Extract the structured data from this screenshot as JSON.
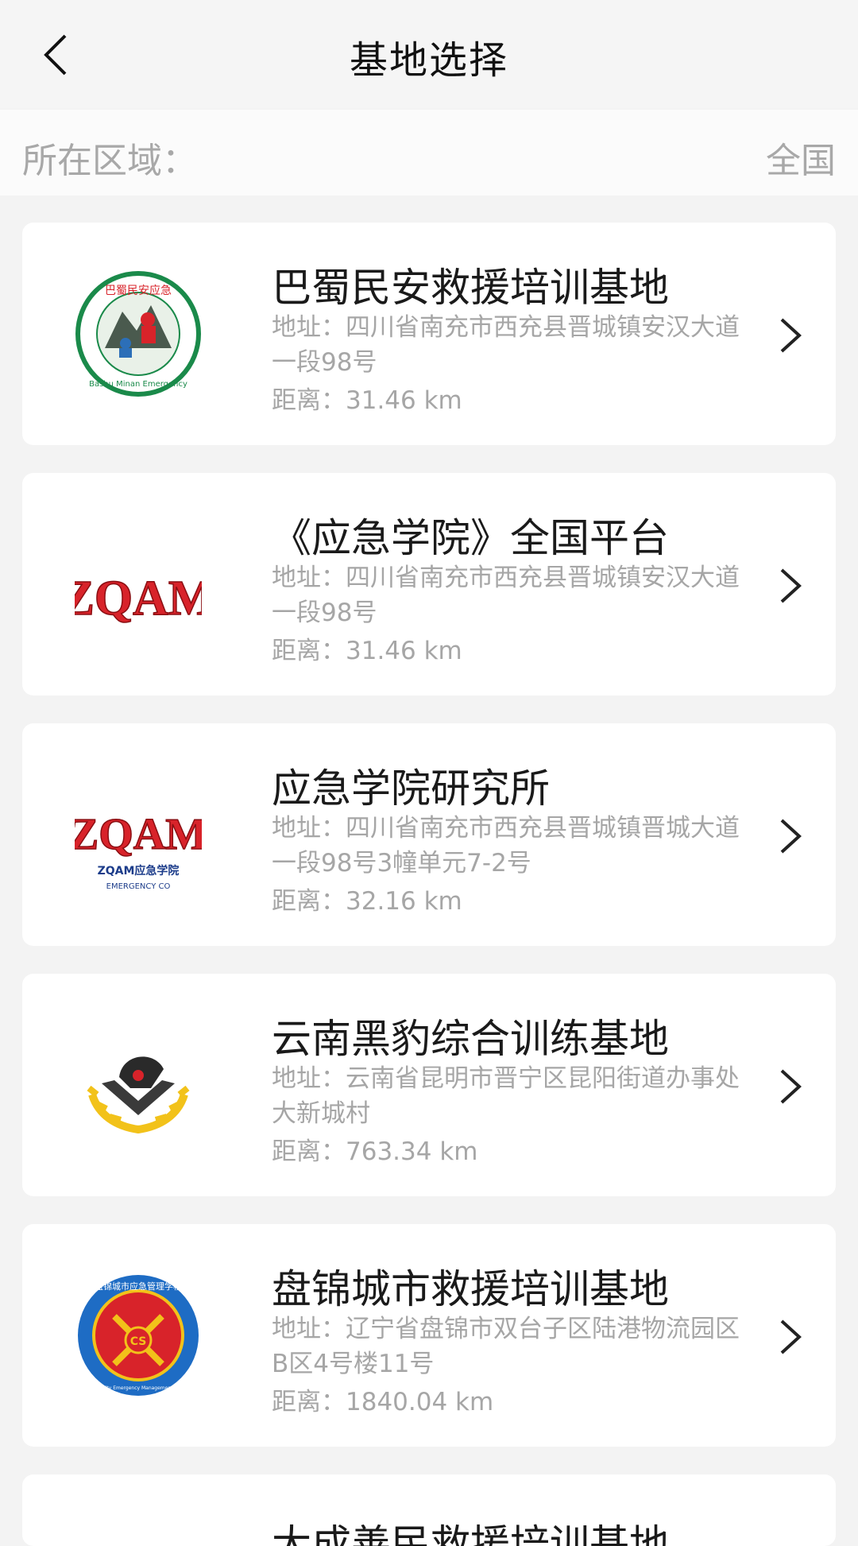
{
  "header": {
    "title": "基地选择"
  },
  "region": {
    "label": "所在区域：",
    "value": "全国"
  },
  "bases": [
    {
      "name": "巴蜀民安救援培训基地",
      "address": "地址：四川省南充市西充县晋城镇安汉大道一段98号",
      "distance": "距离：31.46 km",
      "logo": "bashu-minan-emergency-logo",
      "logo_text_top": "巴蜀民安应急",
      "logo_text_bottom": "Bashu Minan Emergency"
    },
    {
      "name": "《应急学院》全国平台",
      "address": "地址：四川省南充市西充县晋城镇安汉大道一段98号",
      "distance": "距离：31.46 km",
      "logo": "zqam-logo",
      "logo_text": "ZQAM"
    },
    {
      "name": "应急学院研究所",
      "address": "地址：四川省南充市西充县晋城镇晋城大道一段98号3幢单元7-2号",
      "distance": "距离：32.16 km",
      "logo": "zqam-emergency-logo",
      "logo_text": "ZQAM",
      "logo_caption": "ZQAM应急学院",
      "logo_caption_en": "EMERGENCY CO"
    },
    {
      "name": "云南黑豹综合训练基地",
      "address": "地址：云南省昆明市晋宁区昆阳街道办事处大新城村",
      "distance": "距离：763.34 km",
      "logo": "black-panther-emblem-logo"
    },
    {
      "name": "盘锦城市救援培训基地",
      "address": "地址：辽宁省盘锦市双台子区陆港物流园区B区4号楼11号",
      "distance": "距离：1840.04 km",
      "logo": "panjin-emergency-school-logo",
      "logo_text_top": "盘锦城市应急管理学校",
      "logo_text_bottom": "Panjin City Emergency Management School",
      "logo_center": "CS"
    }
  ],
  "partial_base": {
    "name": "大成善民救援培训基地"
  },
  "colors": {
    "accent_red": "#d8232a",
    "text_dark": "#1a1a1a",
    "text_muted": "#a6a6a6"
  }
}
